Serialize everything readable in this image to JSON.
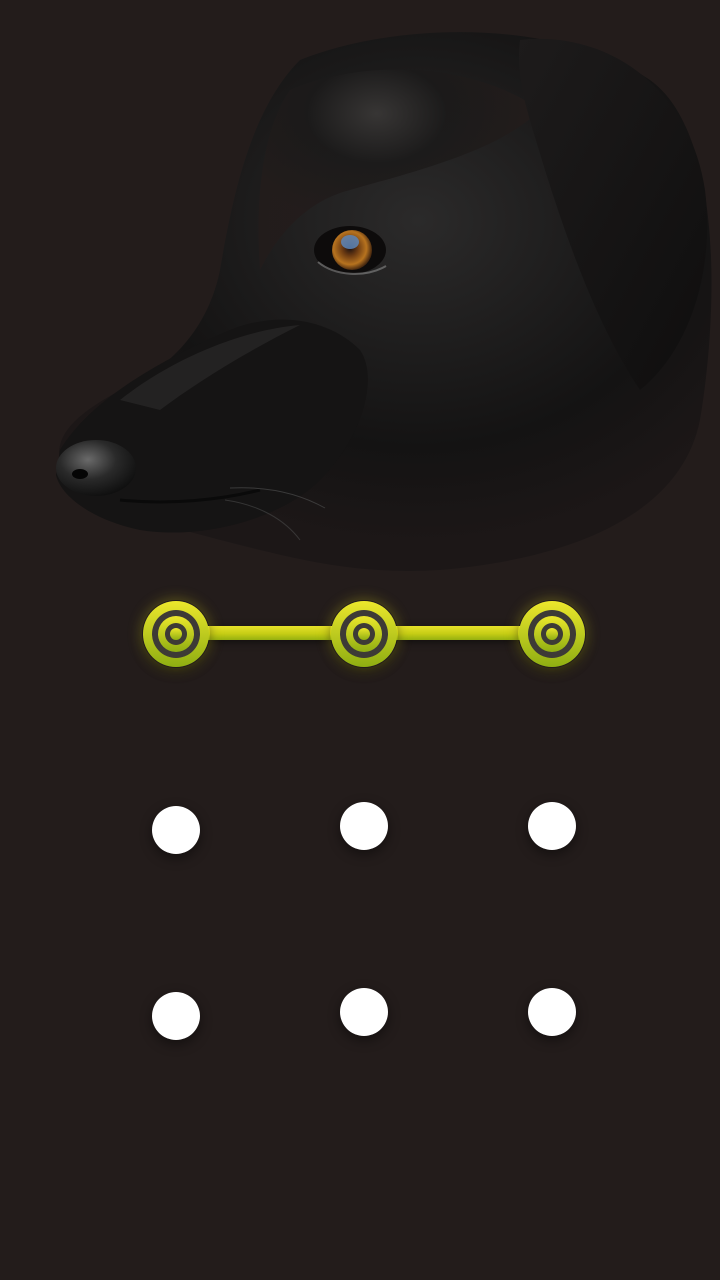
{
  "lock_screen": {
    "wallpaper_subject": "black-dog-icon",
    "accent_color": "#d6d81c",
    "dot_color": "#ffffff",
    "background_color": "#231c1b",
    "pattern_grid": {
      "rows": 3,
      "columns": 3,
      "selected_nodes": [
        1,
        2,
        3
      ]
    }
  }
}
